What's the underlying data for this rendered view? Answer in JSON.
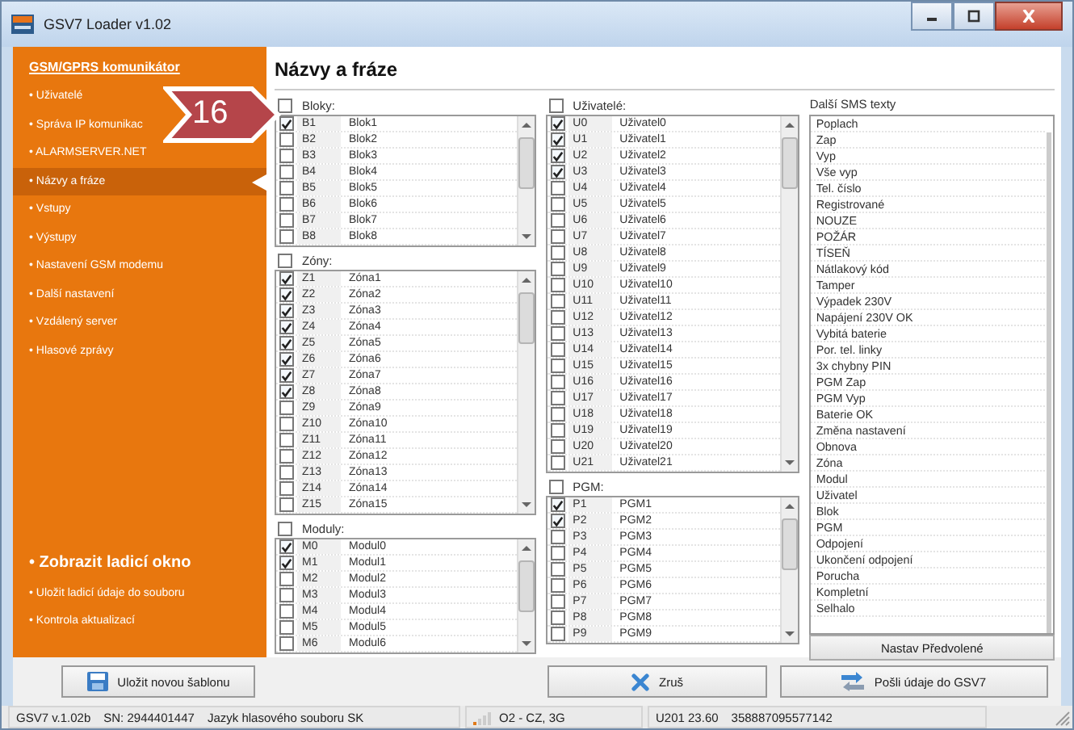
{
  "window": {
    "title": "GSV7 Loader v1.02"
  },
  "sidebar": {
    "heading": "GSM/GPRS komunikátor",
    "items": [
      {
        "label": "• Uživatelé",
        "selected": false
      },
      {
        "label": "• Správa IP komunikac",
        "selected": false
      },
      {
        "label": "• ALARMSERVER.NET",
        "selected": false
      },
      {
        "label": "• Názvy a fráze",
        "selected": true
      },
      {
        "label": "• Vstupy",
        "selected": false
      },
      {
        "label": "• Výstupy",
        "selected": false
      },
      {
        "label": "• Nastavení GSM modemu",
        "selected": false
      },
      {
        "label": "• Další nastavení",
        "selected": false
      },
      {
        "label": "• Vzdálený server",
        "selected": false
      },
      {
        "label": "• Hlasové zprávy",
        "selected": false
      }
    ],
    "footer_items": [
      {
        "label": "• Zobrazit ladicí okno",
        "kind": "large"
      },
      {
        "label": "• Uložit ladicí údaje do souboru",
        "kind": "small"
      },
      {
        "label": "• Kontrola aktualizací",
        "kind": "small"
      }
    ]
  },
  "badge": {
    "label": "16"
  },
  "page_title": "Názvy a fráze",
  "columns": [
    {
      "groups": [
        {
          "label": "Bloky:",
          "checked": false,
          "rows": [
            {
              "code": "B1",
              "name": "Blok1",
              "checked": true
            },
            {
              "code": "B2",
              "name": "Blok2",
              "checked": false
            },
            {
              "code": "B3",
              "name": "Blok3",
              "checked": false
            },
            {
              "code": "B4",
              "name": "Blok4",
              "checked": false
            },
            {
              "code": "B5",
              "name": "Blok5",
              "checked": false
            },
            {
              "code": "B6",
              "name": "Blok6",
              "checked": false
            },
            {
              "code": "B7",
              "name": "Blok7",
              "checked": false
            },
            {
              "code": "B8",
              "name": "Blok8",
              "checked": false
            }
          ]
        },
        {
          "label": "Zóny:",
          "checked": false,
          "rows": [
            {
              "code": "Z1",
              "name": "Zóna1",
              "checked": true
            },
            {
              "code": "Z2",
              "name": "Zóna2",
              "checked": true
            },
            {
              "code": "Z3",
              "name": "Zóna3",
              "checked": true
            },
            {
              "code": "Z4",
              "name": "Zóna4",
              "checked": true
            },
            {
              "code": "Z5",
              "name": "Zóna5",
              "checked": true
            },
            {
              "code": "Z6",
              "name": "Zóna6",
              "checked": true
            },
            {
              "code": "Z7",
              "name": "Zóna7",
              "checked": true
            },
            {
              "code": "Z8",
              "name": "Zóna8",
              "checked": true
            },
            {
              "code": "Z9",
              "name": "Zóna9",
              "checked": false
            },
            {
              "code": "Z10",
              "name": "Zóna10",
              "checked": false
            },
            {
              "code": "Z11",
              "name": "Zóna11",
              "checked": false
            },
            {
              "code": "Z12",
              "name": "Zóna12",
              "checked": false
            },
            {
              "code": "Z13",
              "name": "Zóna13",
              "checked": false
            },
            {
              "code": "Z14",
              "name": "Zóna14",
              "checked": false
            },
            {
              "code": "Z15",
              "name": "Zóna15",
              "checked": false
            }
          ]
        },
        {
          "label": "Moduly:",
          "checked": false,
          "rows": [
            {
              "code": "M0",
              "name": "Modul0",
              "checked": true
            },
            {
              "code": "M1",
              "name": "Modul1",
              "checked": true
            },
            {
              "code": "M2",
              "name": "Modul2",
              "checked": false
            },
            {
              "code": "M3",
              "name": "Modul3",
              "checked": false
            },
            {
              "code": "M4",
              "name": "Modul4",
              "checked": false
            },
            {
              "code": "M5",
              "name": "Modul5",
              "checked": false
            },
            {
              "code": "M6",
              "name": "Modul6",
              "checked": false
            }
          ]
        }
      ]
    },
    {
      "groups": [
        {
          "label": "Uživatelé:",
          "checked": false,
          "rows": [
            {
              "code": "U0",
              "name": "Uživatel0",
              "checked": true
            },
            {
              "code": "U1",
              "name": "Uživatel1",
              "checked": true
            },
            {
              "code": "U2",
              "name": "Uživatel2",
              "checked": true
            },
            {
              "code": "U3",
              "name": "Uživatel3",
              "checked": true
            },
            {
              "code": "U4",
              "name": "Uživatel4",
              "checked": false
            },
            {
              "code": "U5",
              "name": "Uživatel5",
              "checked": false
            },
            {
              "code": "U6",
              "name": "Uživatel6",
              "checked": false
            },
            {
              "code": "U7",
              "name": "Uživatel7",
              "checked": false
            },
            {
              "code": "U8",
              "name": "Uživatel8",
              "checked": false
            },
            {
              "code": "U9",
              "name": "Uživatel9",
              "checked": false
            },
            {
              "code": "U10",
              "name": "Uživatel10",
              "checked": false
            },
            {
              "code": "U11",
              "name": "Uživatel11",
              "checked": false
            },
            {
              "code": "U12",
              "name": "Uživatel12",
              "checked": false
            },
            {
              "code": "U13",
              "name": "Uživatel13",
              "checked": false
            },
            {
              "code": "U14",
              "name": "Uživatel14",
              "checked": false
            },
            {
              "code": "U15",
              "name": "Uživatel15",
              "checked": false
            },
            {
              "code": "U16",
              "name": "Uživatel16",
              "checked": false
            },
            {
              "code": "U17",
              "name": "Uživatel17",
              "checked": false
            },
            {
              "code": "U18",
              "name": "Uživatel18",
              "checked": false
            },
            {
              "code": "U19",
              "name": "Uživatel19",
              "checked": false
            },
            {
              "code": "U20",
              "name": "Uživatel20",
              "checked": false
            },
            {
              "code": "U21",
              "name": "Uživatel21",
              "checked": false
            }
          ]
        },
        {
          "label": "PGM:",
          "checked": false,
          "rows": [
            {
              "code": "P1",
              "name": "PGM1",
              "checked": true
            },
            {
              "code": "P2",
              "name": "PGM2",
              "checked": true
            },
            {
              "code": "P3",
              "name": "PGM3",
              "checked": false
            },
            {
              "code": "P4",
              "name": "PGM4",
              "checked": false
            },
            {
              "code": "P5",
              "name": "PGM5",
              "checked": false
            },
            {
              "code": "P6",
              "name": "PGM6",
              "checked": false
            },
            {
              "code": "P7",
              "name": "PGM7",
              "checked": false
            },
            {
              "code": "P8",
              "name": "PGM8",
              "checked": false
            },
            {
              "code": "P9",
              "name": "PGM9",
              "checked": false
            }
          ]
        }
      ]
    }
  ],
  "sms": {
    "label": "Další SMS texty",
    "items": [
      "Poplach",
      "Zap",
      "Vyp",
      "Vše vyp",
      "Tel. číslo",
      "Registrované",
      "NOUZE",
      "POŽÁR",
      "TÍSEŇ",
      "Nátlakový kód",
      "Tamper",
      "Výpadek 230V",
      "Napájení 230V OK",
      "Vybitá baterie",
      "Por. tel. linky",
      "3x chybny PIN",
      "PGM Zap",
      "PGM Vyp",
      "Baterie OK",
      "Změna nastavení",
      "Obnova",
      "Zóna",
      "Modul",
      "Uživatel",
      "Blok",
      "PGM",
      "Odpojení",
      "Ukončení odpojení",
      "Porucha",
      "Kompletní",
      "Selhalo"
    ],
    "button": "Nastav Předvolené"
  },
  "buttons": {
    "save_template": "Uložit novou šablonu",
    "cancel": "Zruš",
    "send": "Pošli údaje do GSV7"
  },
  "status_bar": {
    "version": "GSV7 v.1.02b",
    "serial": "SN: 2944401447",
    "language": "Jazyk hlasového souboru SK",
    "operator": "O2 - CZ, 3G",
    "device": "U201 23.60",
    "imei": "358887095577142"
  }
}
